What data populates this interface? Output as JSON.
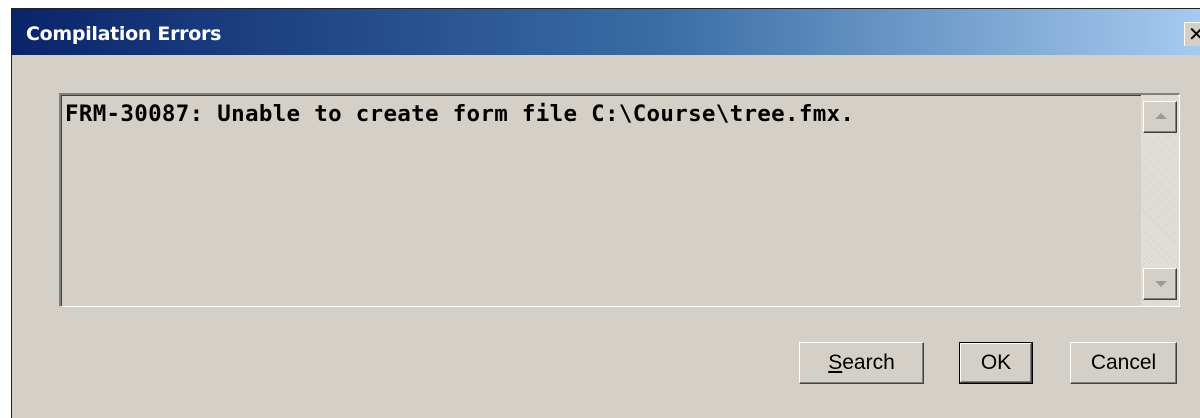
{
  "window": {
    "title": "Compilation Errors",
    "close_glyph": "✕"
  },
  "errors": {
    "message": "FRM-30087: Unable to create form file C:\\Course\\tree.fmx."
  },
  "buttons": {
    "search_mnemonic": "S",
    "search_rest": "earch",
    "ok_label": "OK",
    "cancel_label": "Cancel"
  }
}
